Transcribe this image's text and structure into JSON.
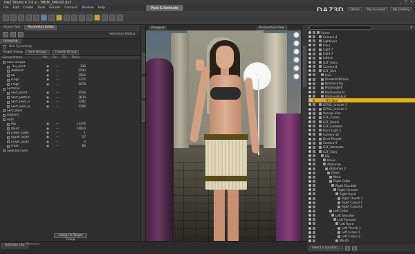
{
  "window": {
    "title": "DAZ Studio 4.7.0.x - TMDK_ORG02.duf",
    "controls": [
      "_",
      "□",
      "×"
    ]
  },
  "menu": [
    "File",
    "Edit",
    "Create",
    "Tools",
    "Render",
    "Connect",
    "Window",
    "Help"
  ],
  "rooms": {
    "tabs": [
      "Pose & Animate"
    ],
    "active": "Pose & Animate"
  },
  "brand": {
    "logo_text": "DAZ3D"
  },
  "top_links": [
    "Home",
    "My Account",
    "My Gallery"
  ],
  "left_panel": {
    "tabs": [
      "Active Tool",
      "Parameter Editor"
    ],
    "selection_label": "Selection Radius:",
    "subtab": "Grouping",
    "option": "Use Symmetry",
    "target_group_label": "Target Group",
    "target_group_value": "Face Groups",
    "choose_label": "Choose Group",
    "tree_header": [
      "Group Name",
      "Vis",
      "Sel",
      "Siz",
      "Polys"
    ],
    "rows": [
      {
        "name": "Face Groups",
        "polys": ""
      },
      {
        "name": "TFG_Skirt",
        "polys": "334"
      },
      {
        "name": "Ambient",
        "polys": "2502"
      },
      {
        "name": "Sk",
        "polys": "1502"
      },
      {
        "name": "Frags",
        "polys": "1374"
      },
      {
        "name": "Fhigh",
        "polys": "1078"
      },
      {
        "name": "Surfaces",
        "polys": ""
      },
      {
        "name": "Skirt_Band",
        "polys": "1508"
      },
      {
        "name": "Skirt_Bottom",
        "polys": "2630"
      },
      {
        "name": "Skirt_Hem_a",
        "polys": "1282"
      },
      {
        "name": "Skirt_Hem_b",
        "polys": "1294"
      },
      {
        "name": "Skirt_Main",
        "polys": ""
      },
      {
        "name": "Regions",
        "polys": ""
      },
      {
        "name": "Antic",
        "polys": ""
      },
      {
        "name": "Hip",
        "polys": "13376"
      },
      {
        "name": "Waist",
        "polys": "14010"
      },
      {
        "name": "Lower_body",
        "polys": "1"
      },
      {
        "name": "Upper_Body",
        "polys": "27"
      },
      {
        "name": "Lower_Body",
        "polys": "0"
      },
      {
        "name": "Front",
        "polys": "83"
      },
      {
        "name": "Selection Sets",
        "polys": ""
      }
    ],
    "assign_button": "Assign To Target Group"
  },
  "viewport": {
    "camera": "Viewport",
    "perspective": "Perspective View"
  },
  "scene_panel": {
    "search_placeholder": "",
    "rows": [
      {
        "name": "Scene",
        "indent": 0,
        "selected": false
      },
      {
        "name": "Camera 4",
        "indent": 1,
        "selected": false
      },
      {
        "name": "Light(vol)",
        "indent": 1,
        "selected": false
      },
      {
        "name": "Fleur",
        "indent": 1,
        "selected": false
      },
      {
        "name": "Light 7",
        "indent": 1,
        "selected": false
      },
      {
        "name": "Light 7",
        "indent": 1,
        "selected": false
      },
      {
        "name": "Lattice",
        "indent": 1,
        "selected": false
      },
      {
        "name": "G2F_Hairs",
        "indent": 1,
        "selected": false
      },
      {
        "name": "Camera 8",
        "indent": 1,
        "selected": false
      },
      {
        "name": "G2F_Skin",
        "indent": 1,
        "selected": false
      },
      {
        "name": "Hair",
        "indent": 2,
        "selected": false
      },
      {
        "name": "DiademOfBraids",
        "indent": 2,
        "selected": false
      },
      {
        "name": "NecklaceTop",
        "indent": 2,
        "selected": false
      },
      {
        "name": "MistressBelt",
        "indent": 2,
        "selected": false
      },
      {
        "name": "MistressPants",
        "indent": 2,
        "selected": false
      },
      {
        "name": "MistressBaSuit",
        "indent": 2,
        "selected": false
      },
      {
        "name": "TFG Skirt",
        "indent": 2,
        "selected": true
      },
      {
        "name": "GFASL_Unicide 1",
        "indent": 1,
        "selected": false
      },
      {
        "name": "GFASL_Unicide 2",
        "indent": 1,
        "selected": false
      },
      {
        "name": "Orange Vine",
        "indent": 1,
        "selected": false
      },
      {
        "name": "G2F_Cerizo",
        "indent": 1,
        "selected": false
      },
      {
        "name": "G2F_Dazlle",
        "indent": 1,
        "selected": false
      },
      {
        "name": "G2F_Goddess",
        "indent": 1,
        "selected": false
      },
      {
        "name": "Point Light 2",
        "indent": 1,
        "selected": false
      },
      {
        "name": "Camera 10",
        "indent": 1,
        "selected": false
      },
      {
        "name": "DrumTemple",
        "indent": 1,
        "selected": false
      },
      {
        "name": "Camera 9",
        "indent": 1,
        "selected": false
      },
      {
        "name": "G2F_Alternate",
        "indent": 1,
        "selected": false
      },
      {
        "name": "G2F_Fairy",
        "indent": 1,
        "selected": false
      },
      {
        "name": "Hip",
        "indent": 2,
        "selected": false
      },
      {
        "name": "Pelvis",
        "indent": 3,
        "selected": false
      },
      {
        "name": "Abdomen",
        "indent": 3,
        "selected": false
      },
      {
        "name": "Abdomen 2",
        "indent": 4,
        "selected": false
      },
      {
        "name": "Chest",
        "indent": 5,
        "selected": false
      },
      {
        "name": "Neck",
        "indent": 6,
        "selected": false
      },
      {
        "name": "Right Collar",
        "indent": 6,
        "selected": false
      },
      {
        "name": "Right Shoulder",
        "indent": 7,
        "selected": false
      },
      {
        "name": "Right Forearm",
        "indent": 8,
        "selected": false
      },
      {
        "name": "Right Hand",
        "indent": 9,
        "selected": false
      },
      {
        "name": "Right Thumb 1",
        "indent": 10,
        "selected": false
      },
      {
        "name": "Right Carpal 1",
        "indent": 10,
        "selected": false
      },
      {
        "name": "Right Carpal 2",
        "indent": 10,
        "selected": false
      },
      {
        "name": "Left Collar",
        "indent": 6,
        "selected": false
      },
      {
        "name": "Left Shoulder",
        "indent": 7,
        "selected": false
      },
      {
        "name": "Left Forearm",
        "indent": 8,
        "selected": false
      },
      {
        "name": "Left Hand",
        "indent": 9,
        "selected": false
      },
      {
        "name": "Left Thumb 1",
        "indent": 10,
        "selected": false
      },
      {
        "name": "Left Carpal 1",
        "indent": 10,
        "selected": false
      },
      {
        "name": "Left Carpal 2",
        "indent": 10,
        "selected": false
      },
      {
        "name": "Mouth",
        "indent": 9,
        "selected": false
      }
    ],
    "bottom_select": "Select a Location..."
  },
  "status": {
    "tab": "Animate Lite",
    "tab2": "Timeline"
  },
  "colors": {
    "selection": "#e7b21c",
    "panel": "#2e2e2e"
  }
}
